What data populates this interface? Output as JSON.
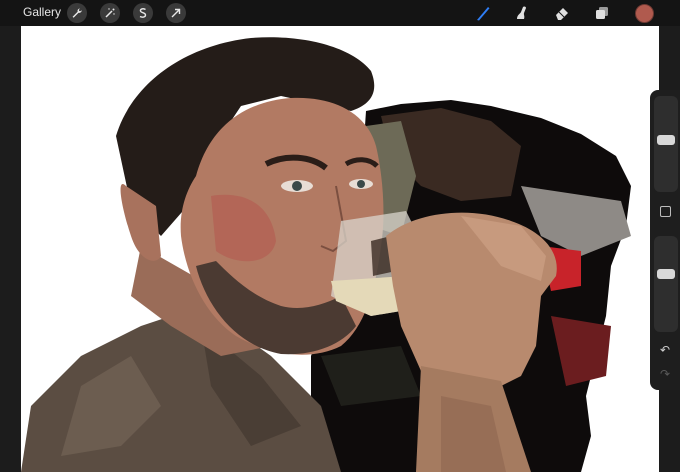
{
  "topbar": {
    "gallery_label": "Gallery",
    "left_tools": [
      {
        "name": "wrench-icon"
      },
      {
        "name": "magic-wand-icon"
      },
      {
        "name": "selection-s-icon"
      },
      {
        "name": "transform-arrow-icon"
      }
    ],
    "right_tools": [
      {
        "name": "brush-icon",
        "active": true
      },
      {
        "name": "smudge-icon"
      },
      {
        "name": "eraser-icon"
      },
      {
        "name": "layers-icon"
      }
    ],
    "current_color": "#b05a4e",
    "accent_color": "#2f7ef6"
  },
  "sidebar": {
    "brush_size_slider": {
      "level": 0.55
    },
    "opacity_slider": {
      "level": 0.62
    },
    "modify_button": "square-icon",
    "undo": "↶",
    "redo": "↷"
  }
}
